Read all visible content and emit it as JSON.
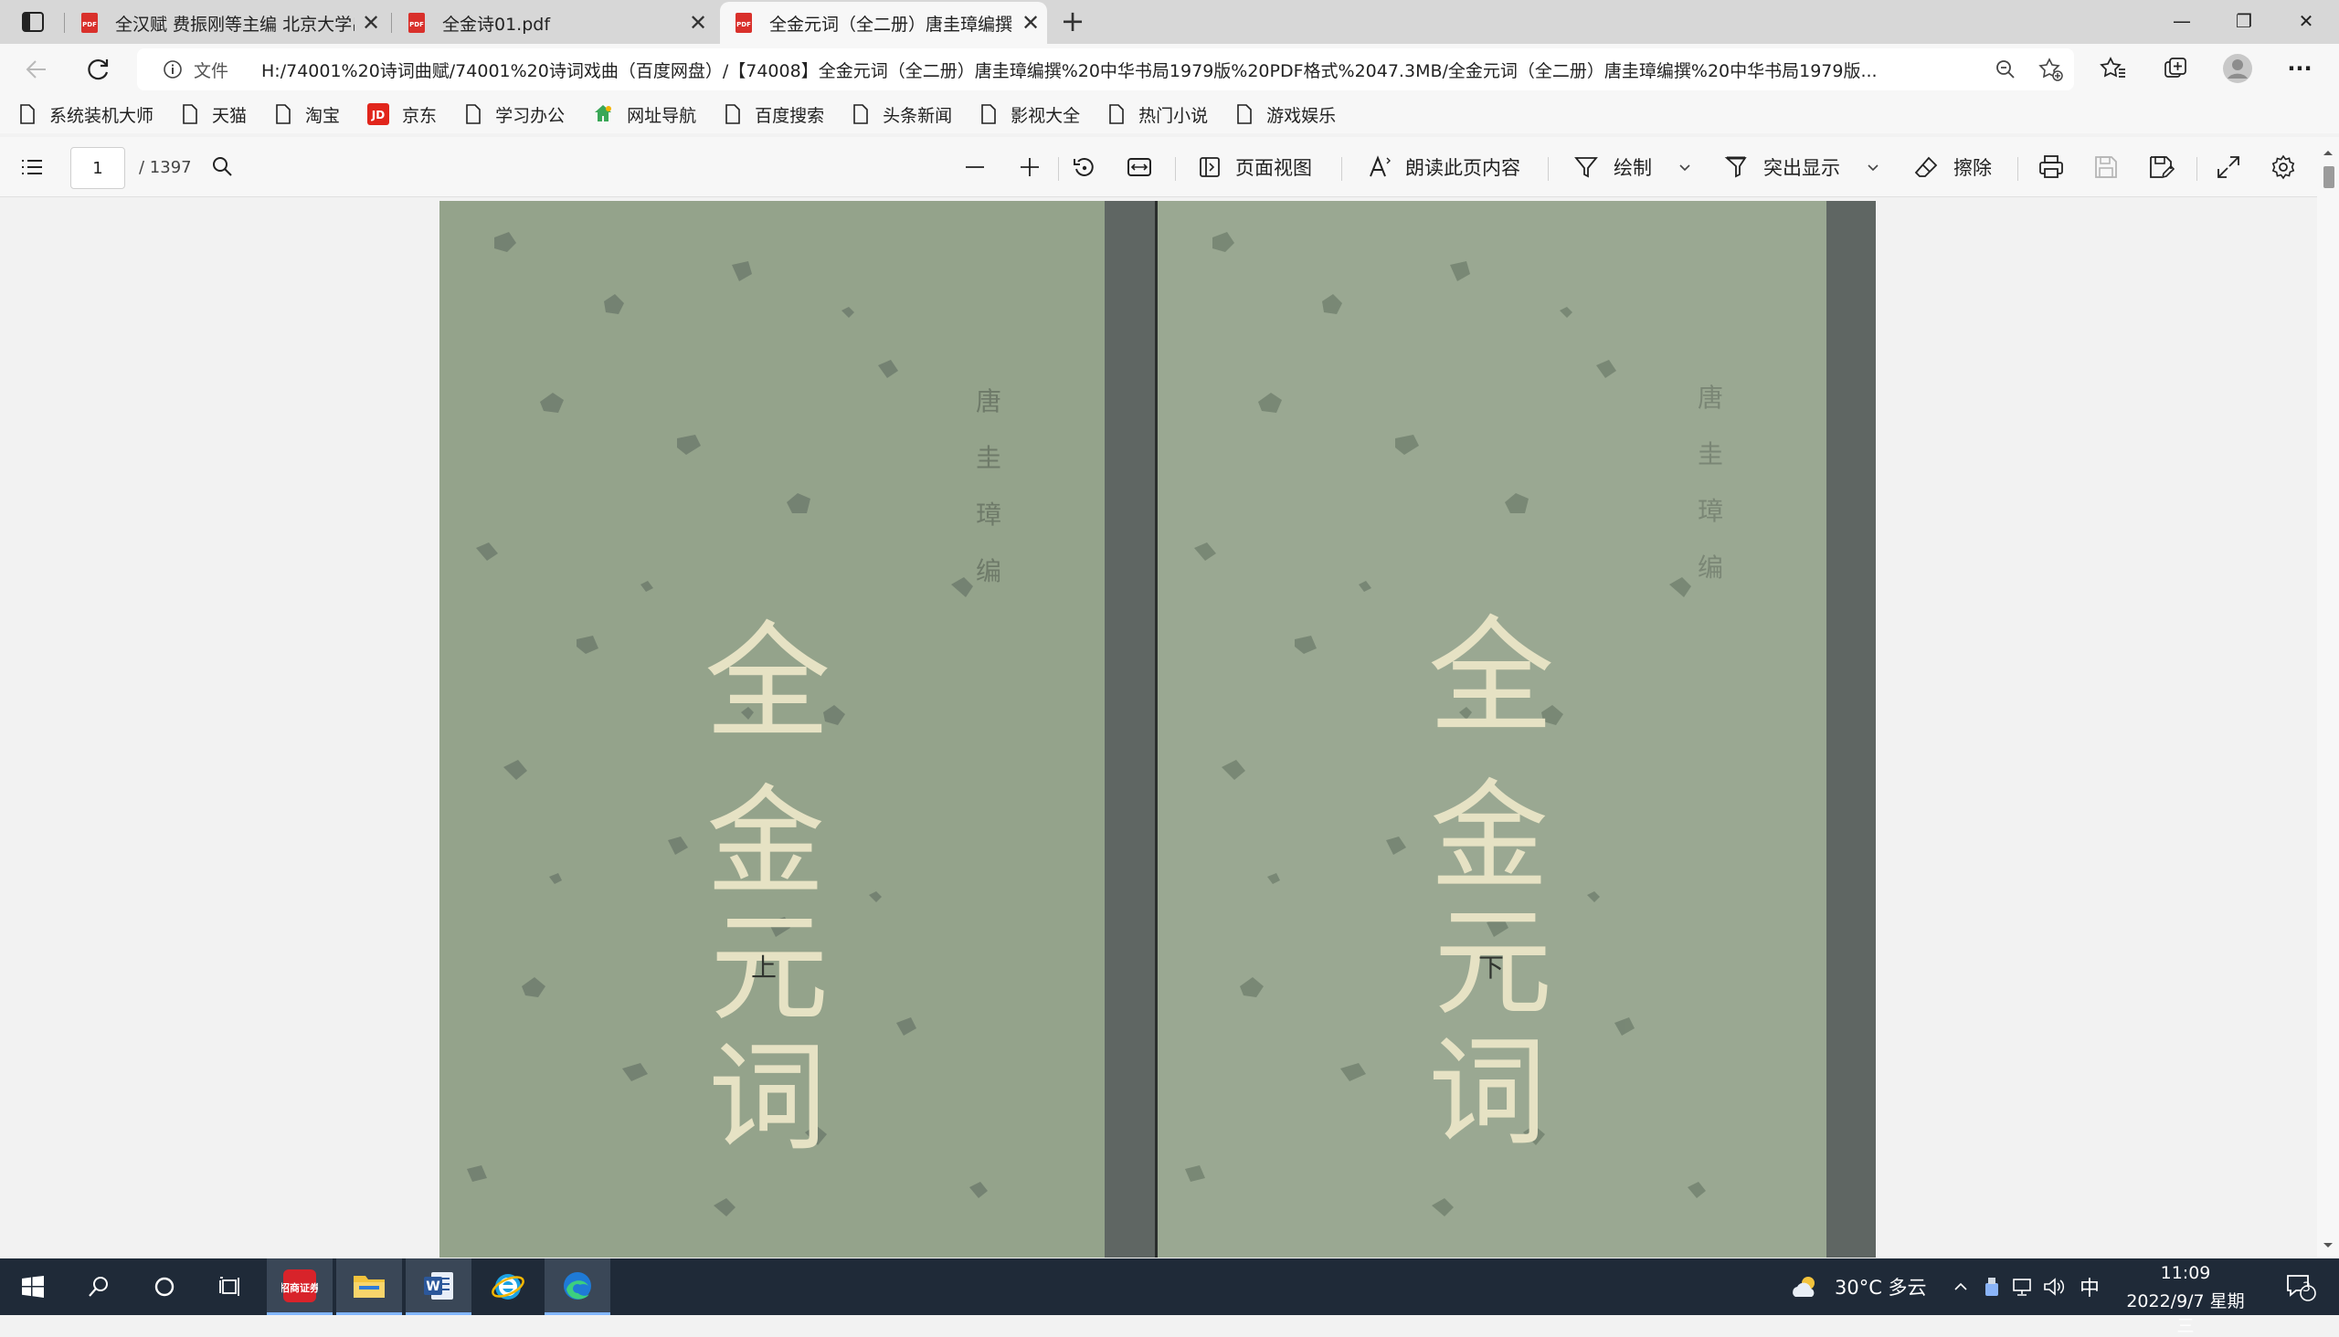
{
  "browser": {
    "tabs": [
      {
        "title": "全汉赋 费振刚等主编 北京大学出",
        "close": "✕"
      },
      {
        "title": "全金诗01.pdf",
        "close": "✕"
      },
      {
        "title": "全金元词（全二册）唐圭璋编撰",
        "close": "✕"
      }
    ],
    "new_tab": "+",
    "window_controls": {
      "minimize": "—",
      "maximize": "❐",
      "close": "✕"
    },
    "address": {
      "scheme_label": "文件",
      "url": "H:/74001%20诗词曲赋/74001%20诗词戏曲（百度网盘）/【74008】全金元词（全二册）唐圭璋编撰%20中华书局1979版%20PDF格式%2047.3MB/全金元词（全二册）唐圭璋编撰%20中华书局1979版..."
    },
    "bookmarks": [
      "系统装机大师",
      "天猫",
      "淘宝",
      "京东",
      "学习办公",
      "网址导航",
      "百度搜索",
      "头条新闻",
      "影视大全",
      "热门小说",
      "游戏娱乐"
    ],
    "more": "···"
  },
  "pdf_toolbar": {
    "page_current": "1",
    "page_total": "/ 1397",
    "page_view": "页面视图",
    "read_aloud": "朗读此页内容",
    "draw": "绘制",
    "highlight": "突出显示",
    "erase": "擦除"
  },
  "document": {
    "title_chars": [
      "全",
      "金",
      "元",
      "词"
    ],
    "author_chars": [
      "唐",
      "圭",
      "璋",
      "编"
    ],
    "volume_left": "上",
    "volume_right": "下"
  },
  "taskbar": {
    "weather": "30°C  多云",
    "ime": "中",
    "time": "11:09",
    "date": "2022/9/7 星期三",
    "notifications": "3",
    "app_label_zhaoshang": "招商证券"
  },
  "colors": {
    "cover_green": "#94a38b",
    "spine_gray": "#5f6663",
    "title_cream": "#e6e2c4",
    "taskbar": "#1f2a38",
    "edge_blue": "#1f7ad6"
  }
}
